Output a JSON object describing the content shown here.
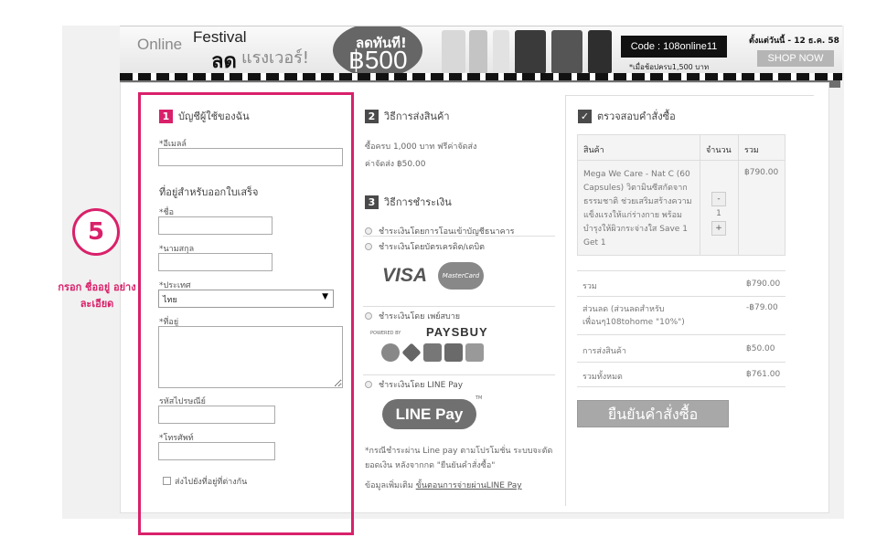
{
  "banner": {
    "online": "Online",
    "festival": "Festival",
    "lod": "ลด",
    "power": "แรงเวอร์!",
    "discount_top": "ลดทันที!",
    "discount_amount": "฿500",
    "code": "Code : 108online11",
    "condition": "*เมื่อช้อปครบ1,500 บาท",
    "from_date": "ตั้งแต่วันนี้ - 12 ธ.ค. 58",
    "shop_now": "SHOP NOW"
  },
  "account": {
    "number": "1",
    "title": "บัญชีผู้ใช้ของฉัน",
    "email_label": "*อีเมลล์",
    "email_value": "",
    "billing_title": "ที่อยู่สำหรับออกใบเสร็จ",
    "first_name_label": "*ชื่อ",
    "last_name_label": "*นามสกุล",
    "country_label": "*ประเทศ",
    "country_value": "ไทย",
    "address_label": "*ที่อยู่",
    "postcode_label": "รหัสไปรษณีย์",
    "phone_label": "*โทรศัพท์",
    "ship_other_label": "ส่งไปยังที่อยู่ที่ต่างกัน"
  },
  "shipping": {
    "number": "2",
    "title": "วิธีการส่งสินค้า",
    "line1": "ซื้อครบ 1,000 บาท ฟรีค่าจัดส่ง",
    "line2": "ค่าจัดส่ง ฿50.00"
  },
  "payment": {
    "number": "3",
    "title": "วิธีการชำระเงิน",
    "opt_transfer": "ชำระเงินโดยการโอนเข้าบัญชีธนาคาร",
    "opt_card": "ชำระเงินโดยบัตรเครดิต/เดบิต",
    "visa": "VISA",
    "mastercard": "MasterCard",
    "opt_paysbuy": "ชำระเงินโดย เพย์สบาย",
    "powered_by": "POWERED BY",
    "paysbuy": "PAYSBUY",
    "opt_linepay": "ชำระเงินโดย LINE Pay",
    "linepay": "LINE Pay",
    "tm": "TM",
    "note": "*กรณีชำระผ่าน Line pay ตามโปรโมชั่น ระบบจะตัดยอดเงิน หลังจากกด \"ยืนยันคำสั่งซื้อ\"",
    "more_prefix": "ข้อมูลเพิ่มเติม",
    "more_link": "ขั้นตอนการจ่ายผ่านLINE Pay"
  },
  "review": {
    "title": "ตรวจสอบคำสั่งซื้อ",
    "col_product": "สินค้า",
    "col_qty": "จำนวน",
    "col_total": "รวม",
    "product_name": "Mega We Care - Nat C (60 Capsules) วิตามินซีสกัดจากธรรมชาติ ช่วยเสริมสร้างความแข็งแรงให้แก่ร่างกาย พร้อมบำรุงให้ผิวกระจ่างใส Save 1 Get 1",
    "qty": "1",
    "minus": "-",
    "plus": "+",
    "product_total": "฿790.00",
    "subtotal_label": "รวม",
    "subtotal": "฿790.00",
    "discount_label": "ส่วนลด (ส่วนลดสำหรับเพื่อนๆ108tohome \"10%\")",
    "discount": "-฿79.00",
    "shipping_label": "การส่งสินค้า",
    "shipping": "฿50.00",
    "grand_label": "รวมทั้งหมด",
    "grand": "฿761.00",
    "confirm": "ยืนยันคำสั่งซื้อ"
  },
  "callout": {
    "step": "5",
    "text": "กรอก ชื่ออยู่ อย่างละเอียด"
  },
  "colors": {
    "accent": "#d9216a",
    "dark_badge": "#4a4a4a"
  }
}
